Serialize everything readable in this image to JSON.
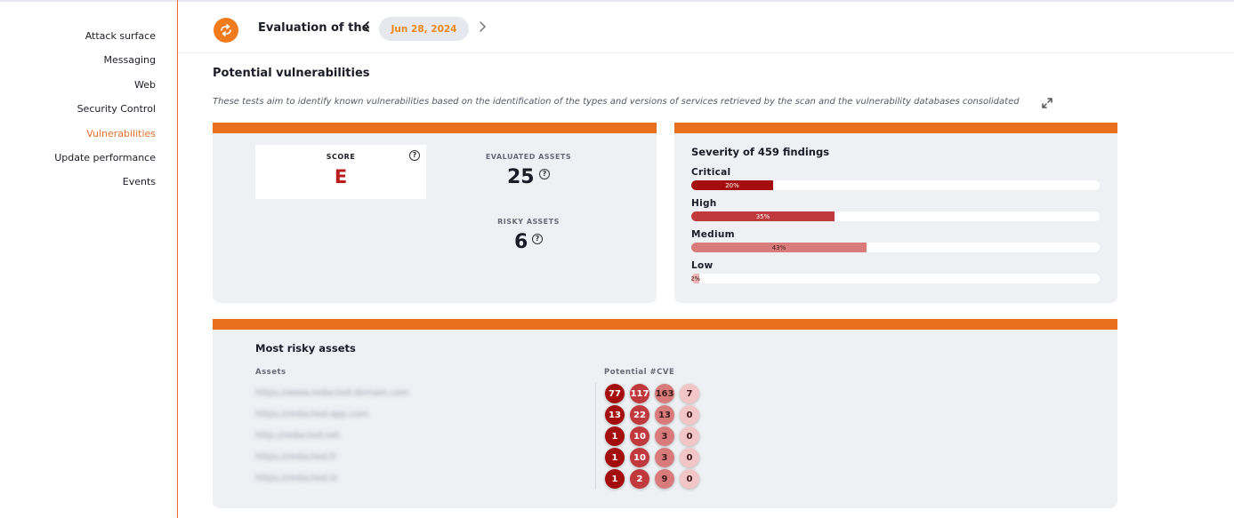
{
  "sidebar": {
    "items": [
      {
        "label": "Attack surface"
      },
      {
        "label": "Messaging"
      },
      {
        "label": "Web"
      },
      {
        "label": "Security Control"
      },
      {
        "label": "Vulnerabilities",
        "active": true
      },
      {
        "label": "Update performance"
      },
      {
        "label": "Events"
      }
    ]
  },
  "header": {
    "title": "Evaluation of the",
    "prev_icon": "chevron-left-icon",
    "next_icon": "chevron-right-icon",
    "date": "Jun 28, 2024"
  },
  "section": {
    "title": "Potential vulnerabilities",
    "description": "These tests aim to identify known vulnerabilities based on the identification of the types and versions of services retrieved by the scan and the vulnerability databases consolidated",
    "expand_icon": "expand-icon"
  },
  "summary": {
    "score_label": "SCORE",
    "score_value": "E",
    "evaluated_label": "EVALUATED ASSETS",
    "evaluated_value": "25",
    "risky_label": "RISKY ASSETS",
    "risky_value": "6",
    "help_glyph": "?"
  },
  "severity": {
    "title": "Severity of 459 findings",
    "levels": [
      {
        "label": "Critical",
        "percent_text": "20%",
        "percent": 20,
        "color": "#a50e0e",
        "text_color": "#ffffff"
      },
      {
        "label": "High",
        "percent_text": "35%",
        "percent": 35,
        "color": "#c0393d",
        "text_color": "#ffffff"
      },
      {
        "label": "Medium",
        "percent_text": "43%",
        "percent": 43,
        "color": "#d97b7b",
        "text_color": "#3a1a1a"
      },
      {
        "label": "Low",
        "percent_text": "2%",
        "percent": 2,
        "color": "#ecb4b4",
        "text_color": "#3a1a1a"
      }
    ]
  },
  "risky_assets": {
    "title": "Most risky assets",
    "col_assets": "Assets",
    "col_cve": "Potential #CVE",
    "rows": [
      {
        "asset": "https://www.redacted-domain.com",
        "cve": [
          "77",
          "117",
          "163",
          "7"
        ]
      },
      {
        "asset": "https://redacted-app.com",
        "cve": [
          "13",
          "22",
          "13",
          "0"
        ]
      },
      {
        "asset": "http://redacted.net",
        "cve": [
          "1",
          "10",
          "3",
          "0"
        ]
      },
      {
        "asset": "https://redacted.fr",
        "cve": [
          "1",
          "10",
          "3",
          "0"
        ]
      },
      {
        "asset": "https://redacted.io",
        "cve": [
          "1",
          "2",
          "9",
          "0"
        ]
      }
    ],
    "cve_colors": [
      "#a50e0e",
      "#c0393d",
      "#d97b7b",
      "#f2c6c6"
    ],
    "cve_text_colors": [
      "#ffffff",
      "#ffffff",
      "#3a1a1a",
      "#3a1a1a"
    ]
  }
}
